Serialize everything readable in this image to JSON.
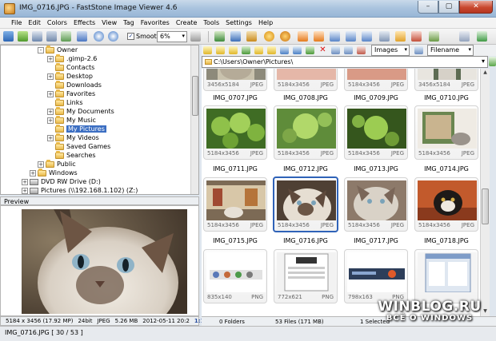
{
  "window": {
    "title": "IMG_0716.JPG  -  FastStone Image Viewer 4.6",
    "min": "–",
    "max": "▢",
    "close": "✕"
  },
  "menu": [
    "File",
    "Edit",
    "Colors",
    "Effects",
    "View",
    "Tag",
    "Favorites",
    "Create",
    "Tools",
    "Settings",
    "Help"
  ],
  "toolbar": {
    "smooth_label": "Smooth",
    "smooth_checked": "✓",
    "zoom_value": "6%",
    "view_filter": "Images",
    "sort_by": "Filename"
  },
  "tree": [
    {
      "label": "Owner",
      "level": 0,
      "expander": "-"
    },
    {
      "label": ".gimp-2.6",
      "level": 1,
      "expander": "+"
    },
    {
      "label": "Contacts",
      "level": 1,
      "expander": ""
    },
    {
      "label": "Desktop",
      "level": 1,
      "expander": "+"
    },
    {
      "label": "Downloads",
      "level": 1,
      "expander": ""
    },
    {
      "label": "Favorites",
      "level": 1,
      "expander": "+"
    },
    {
      "label": "Links",
      "level": 1,
      "expander": ""
    },
    {
      "label": "My Documents",
      "level": 1,
      "expander": "+"
    },
    {
      "label": "My Music",
      "level": 1,
      "expander": "+"
    },
    {
      "label": "My Pictures",
      "level": 1,
      "expander": "",
      "selected": true
    },
    {
      "label": "My Videos",
      "level": 1,
      "expander": "+"
    },
    {
      "label": "Saved Games",
      "level": 1,
      "expander": ""
    },
    {
      "label": "Searches",
      "level": 1,
      "expander": ""
    },
    {
      "label": "Public",
      "level": 0,
      "expander": "+"
    },
    {
      "label": "Windows",
      "level": -1,
      "expander": "+"
    },
    {
      "label": "DVD RW Drive (D:)",
      "level": -2,
      "expander": "+"
    },
    {
      "label": "Pictures (\\\\192.168.1.102) (Z:)",
      "level": -2,
      "expander": "+"
    }
  ],
  "preview": {
    "label": "Preview",
    "info": [
      "5184 x 3456 (17.92 MP)",
      "24bit",
      "JPEG",
      "5.26 MB",
      "2012-05-11 20:2",
      "1:1"
    ]
  },
  "path": {
    "value": "C:\\Users\\Owner\\Pictures\\",
    "arrow": "▾"
  },
  "thumbnails": [
    {
      "name": "IMG_0707.JPG",
      "dims": "3456x5184",
      "fmt": "JPEG"
    },
    {
      "name": "IMG_0708.JPG",
      "dims": "5184x3456",
      "fmt": "JPEG"
    },
    {
      "name": "IMG_0709.JPG",
      "dims": "5184x3456",
      "fmt": "JPEG"
    },
    {
      "name": "IMG_0710.JPG",
      "dims": "3456x5184",
      "fmt": "JPEG"
    },
    {
      "name": "IMG_0711.JPG",
      "dims": "5184x3456",
      "fmt": "JPEG"
    },
    {
      "name": "IMG_0712.JPG",
      "dims": "5184x3456",
      "fmt": "JPEG"
    },
    {
      "name": "IMG_0713.JPG",
      "dims": "5184x3456",
      "fmt": "JPEG"
    },
    {
      "name": "IMG_0714.JPG",
      "dims": "5184x3456",
      "fmt": "JPEG"
    },
    {
      "name": "IMG_0715.JPG",
      "dims": "5184x3456",
      "fmt": "JPEG"
    },
    {
      "name": "IMG_0716.JPG",
      "dims": "5184x3456",
      "fmt": "JPEG",
      "selected": true
    },
    {
      "name": "IMG_0717.JPG",
      "dims": "5184x3456",
      "fmt": "JPEG"
    },
    {
      "name": "IMG_0718.JPG",
      "dims": "5184x3456",
      "fmt": "JPEG"
    },
    {
      "name": "",
      "dims": "835x140",
      "fmt": "PNG"
    },
    {
      "name": "",
      "dims": "772x621",
      "fmt": "PNG"
    },
    {
      "name": "",
      "dims": "798x163",
      "fmt": "PNG"
    },
    {
      "name": "",
      "dims": "",
      "fmt": ""
    }
  ],
  "status": {
    "folders": "0 Folders",
    "files": "53 Files (171 MB)",
    "selected": "1 Selected"
  },
  "bottom": {
    "filename": "IMG_0716.JPG [ 30 / 53 ]"
  },
  "watermark": {
    "line1": "WINBLOG.RU",
    "line2": "ВСЁ О WINDOWS"
  }
}
